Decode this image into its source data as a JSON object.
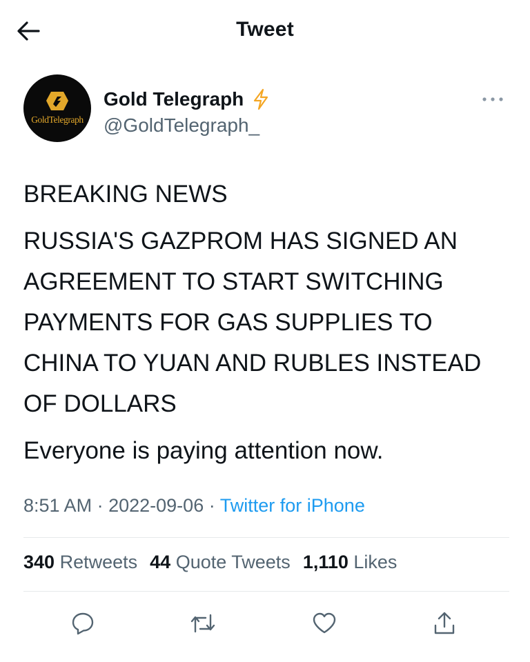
{
  "header": {
    "title": "Tweet",
    "back_icon": "arrow-left-icon"
  },
  "author": {
    "avatar_wordmark": "GoldTelegraph",
    "display_name": "Gold Telegraph",
    "badge_icon": "lightning-bolt-icon",
    "handle": "@GoldTelegraph_",
    "more_icon": "ellipsis-icon"
  },
  "tweet": {
    "paragraphs": [
      "BREAKING NEWS",
      "RUSSIA'S GAZPROM HAS SIGNED AN AGREEMENT TO START SWITCHING PAYMENTS FOR GAS SUPPLIES TO CHINA TO YUAN AND RUBLES INSTEAD OF DOLLARS",
      "Everyone is paying attention now."
    ]
  },
  "meta": {
    "time": "8:51 AM",
    "date": "2022-09-06",
    "separator": "·",
    "source": "Twitter for iPhone"
  },
  "stats": {
    "retweets": {
      "count": "340",
      "label": "Retweets"
    },
    "quote_tweets": {
      "count": "44",
      "label": "Quote Tweets"
    },
    "likes": {
      "count": "1,110",
      "label": "Likes"
    }
  },
  "actions": [
    {
      "name": "reply",
      "icon": "speech-bubble-icon"
    },
    {
      "name": "retweet",
      "icon": "retweet-arrows-icon"
    },
    {
      "name": "like",
      "icon": "heart-icon"
    },
    {
      "name": "share",
      "icon": "share-upload-icon"
    }
  ],
  "colors": {
    "text": "#0f1419",
    "secondary": "#536471",
    "link": "#1d9bf0",
    "badge": "#f4a623",
    "logo_gold": "#e2a72a",
    "divider": "#e6e9eb"
  }
}
